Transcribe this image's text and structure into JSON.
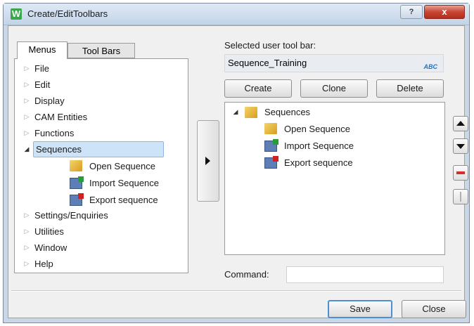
{
  "window": {
    "title": "Create/EditToolbars",
    "app_icon_letter": "W",
    "help_glyph": "?",
    "close_glyph": "x"
  },
  "tabs": [
    {
      "label": "Menus",
      "active": true
    },
    {
      "label": "Tool Bars",
      "active": false
    }
  ],
  "menu_tree": [
    {
      "label": "File",
      "state": "collapsed"
    },
    {
      "label": "Edit",
      "state": "collapsed"
    },
    {
      "label": "Display",
      "state": "collapsed"
    },
    {
      "label": "CAM Entities",
      "state": "collapsed"
    },
    {
      "label": "Functions",
      "state": "collapsed"
    },
    {
      "label": "Sequences",
      "state": "expanded",
      "selected": true,
      "children": [
        {
          "label": "Open Sequence",
          "icon": "folder-open-icon"
        },
        {
          "label": "Import Sequence",
          "icon": "import-sequence-icon"
        },
        {
          "label": "Export sequence",
          "icon": "export-sequence-icon"
        }
      ]
    },
    {
      "label": "Settings/Enquiries",
      "state": "collapsed"
    },
    {
      "label": "Utilities",
      "state": "collapsed"
    },
    {
      "label": "Window",
      "state": "collapsed"
    },
    {
      "label": "Help",
      "state": "collapsed"
    }
  ],
  "toolbar": {
    "selected_label": "Selected user tool bar:",
    "selected_value": "Sequence_Training",
    "spell_icon_text": "ABC"
  },
  "actions": {
    "create": "Create",
    "clone": "Clone",
    "delete": "Delete"
  },
  "toolbar_tree": {
    "root": "Sequences",
    "children": [
      {
        "label": "Open Sequence",
        "icon": "folder-open-icon"
      },
      {
        "label": "Import Sequence",
        "icon": "import-sequence-icon"
      },
      {
        "label": "Export sequence",
        "icon": "export-sequence-icon"
      }
    ]
  },
  "command": {
    "label": "Command:",
    "value": ""
  },
  "footer": {
    "save": "Save",
    "close": "Close"
  },
  "colors": {
    "selection": "#cde3f7",
    "close_button": "#c84432",
    "default_button_border": "#4a90d9"
  }
}
